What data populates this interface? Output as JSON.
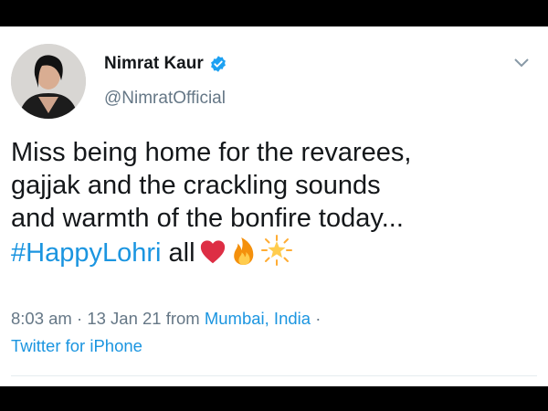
{
  "tweet": {
    "author_name": "Nimrat Kaur",
    "author_handle": "@NimratOfficial",
    "text_lines": [
      "Miss being home for the revarees,",
      "gajjak and the crackling sounds",
      "and warmth of the bonfire today..."
    ],
    "hashtag": "#HappyLohri",
    "hashtag_suffix": " all",
    "time": "8:03 am",
    "separator": " · ",
    "date": "13 Jan 21",
    "from_text": " from ",
    "location": "Mumbai, India",
    "location_suffix": " ·",
    "source": "Twitter for iPhone",
    "emojis": [
      "red-heart",
      "fire",
      "glowing-star"
    ]
  },
  "colors": {
    "link_blue": "#1b95e0",
    "text_dark": "#14171a",
    "text_muted": "#657786",
    "verified_blue": "#1da1f2",
    "heart_red": "#dd2e44"
  }
}
